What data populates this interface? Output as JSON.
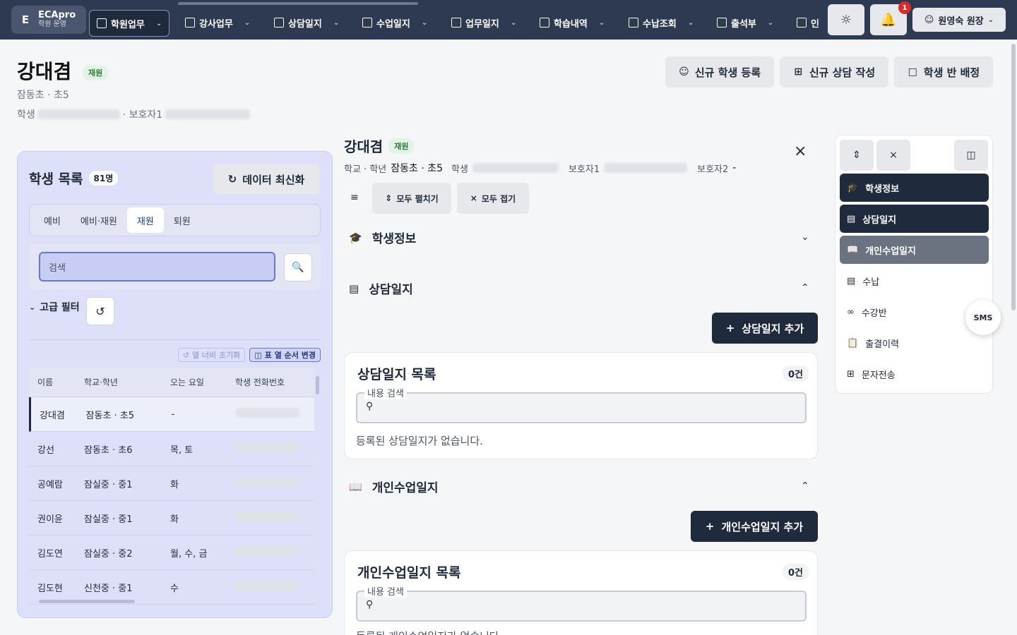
{
  "app": {
    "logo_letter": "E",
    "name": "ECApro",
    "sub": "학원 운영"
  },
  "nav": [
    {
      "label": "학원업무",
      "active": true
    },
    {
      "label": "강사업무"
    },
    {
      "label": "상담일지"
    },
    {
      "label": "수업일지"
    },
    {
      "label": "업무일지"
    },
    {
      "label": "학습내역"
    },
    {
      "label": "수납조회"
    },
    {
      "label": "출석부"
    },
    {
      "label": "인"
    }
  ],
  "header": {
    "notif_count": "1",
    "user": "원영숙 원장"
  },
  "student": {
    "name": "강대겸",
    "status": "재원",
    "school_grade": "잠동초 · 초5",
    "phone_label": "학생",
    "guardian_label": "· 보호자1"
  },
  "actions": {
    "register": "신규 학생 등록",
    "consult": "신규 상담 작성",
    "assign": "학생 반 배정"
  },
  "list": {
    "title": "학생 목록",
    "count": "81명",
    "refresh": "데이터 최신화",
    "tabs": [
      "예비",
      "예비·재원",
      "재원",
      "퇴원"
    ],
    "search_placeholder": "검색",
    "adv_filter": "고급 필터",
    "reset_width": "열 너비 초기화",
    "reorder": "표 열 순서 변경",
    "columns": [
      "이름",
      "학교·학년",
      "오는 요일",
      "학생 전화번호"
    ],
    "rows": [
      {
        "name": "강대겸",
        "school": "잠동초 · 초5",
        "days": "-"
      },
      {
        "name": "강선",
        "school": "잠동초 · 초6",
        "days": "목, 토"
      },
      {
        "name": "공예람",
        "school": "잠실중 · 중1",
        "days": "화"
      },
      {
        "name": "권이윤",
        "school": "잠실중 · 중1",
        "days": "화"
      },
      {
        "name": "김도연",
        "school": "잠실중 · 중2",
        "days": "월, 수, 금"
      },
      {
        "name": "김도현",
        "school": "신천중 · 중1",
        "days": "수"
      }
    ]
  },
  "detail": {
    "name": "강대겸",
    "status": "재원",
    "school_label": "학교 · 학년",
    "school_value": "잠동초 · 초5",
    "phone_label": "학생",
    "guardian1_label": "보호자1",
    "guardian2_label": "보호자2",
    "guardian2_value": "-",
    "expand_all": "모두 펼치기",
    "collapse_all": "모두 접기",
    "sec_info": "학생정보",
    "sec_consult": "상담일지",
    "sec_lesson": "개인수업일지",
    "add_consult": "상담일지 추가",
    "add_lesson": "개인수업일지 추가",
    "consult_card": {
      "title": "상담일지 목록",
      "count": "0건",
      "legend": "내용 검색",
      "empty": "등록된 상담일지가 없습니다."
    },
    "lesson_card": {
      "title": "개인수업일지 목록",
      "count": "0건",
      "legend": "내용 검색",
      "empty": "등록된 개인수업일지가 없습니다."
    }
  },
  "rnav": [
    "학생정보",
    "상담일지",
    "개인수업일지",
    "수납",
    "수강반",
    "출결이력",
    "문자전송"
  ],
  "sms": "SMS"
}
